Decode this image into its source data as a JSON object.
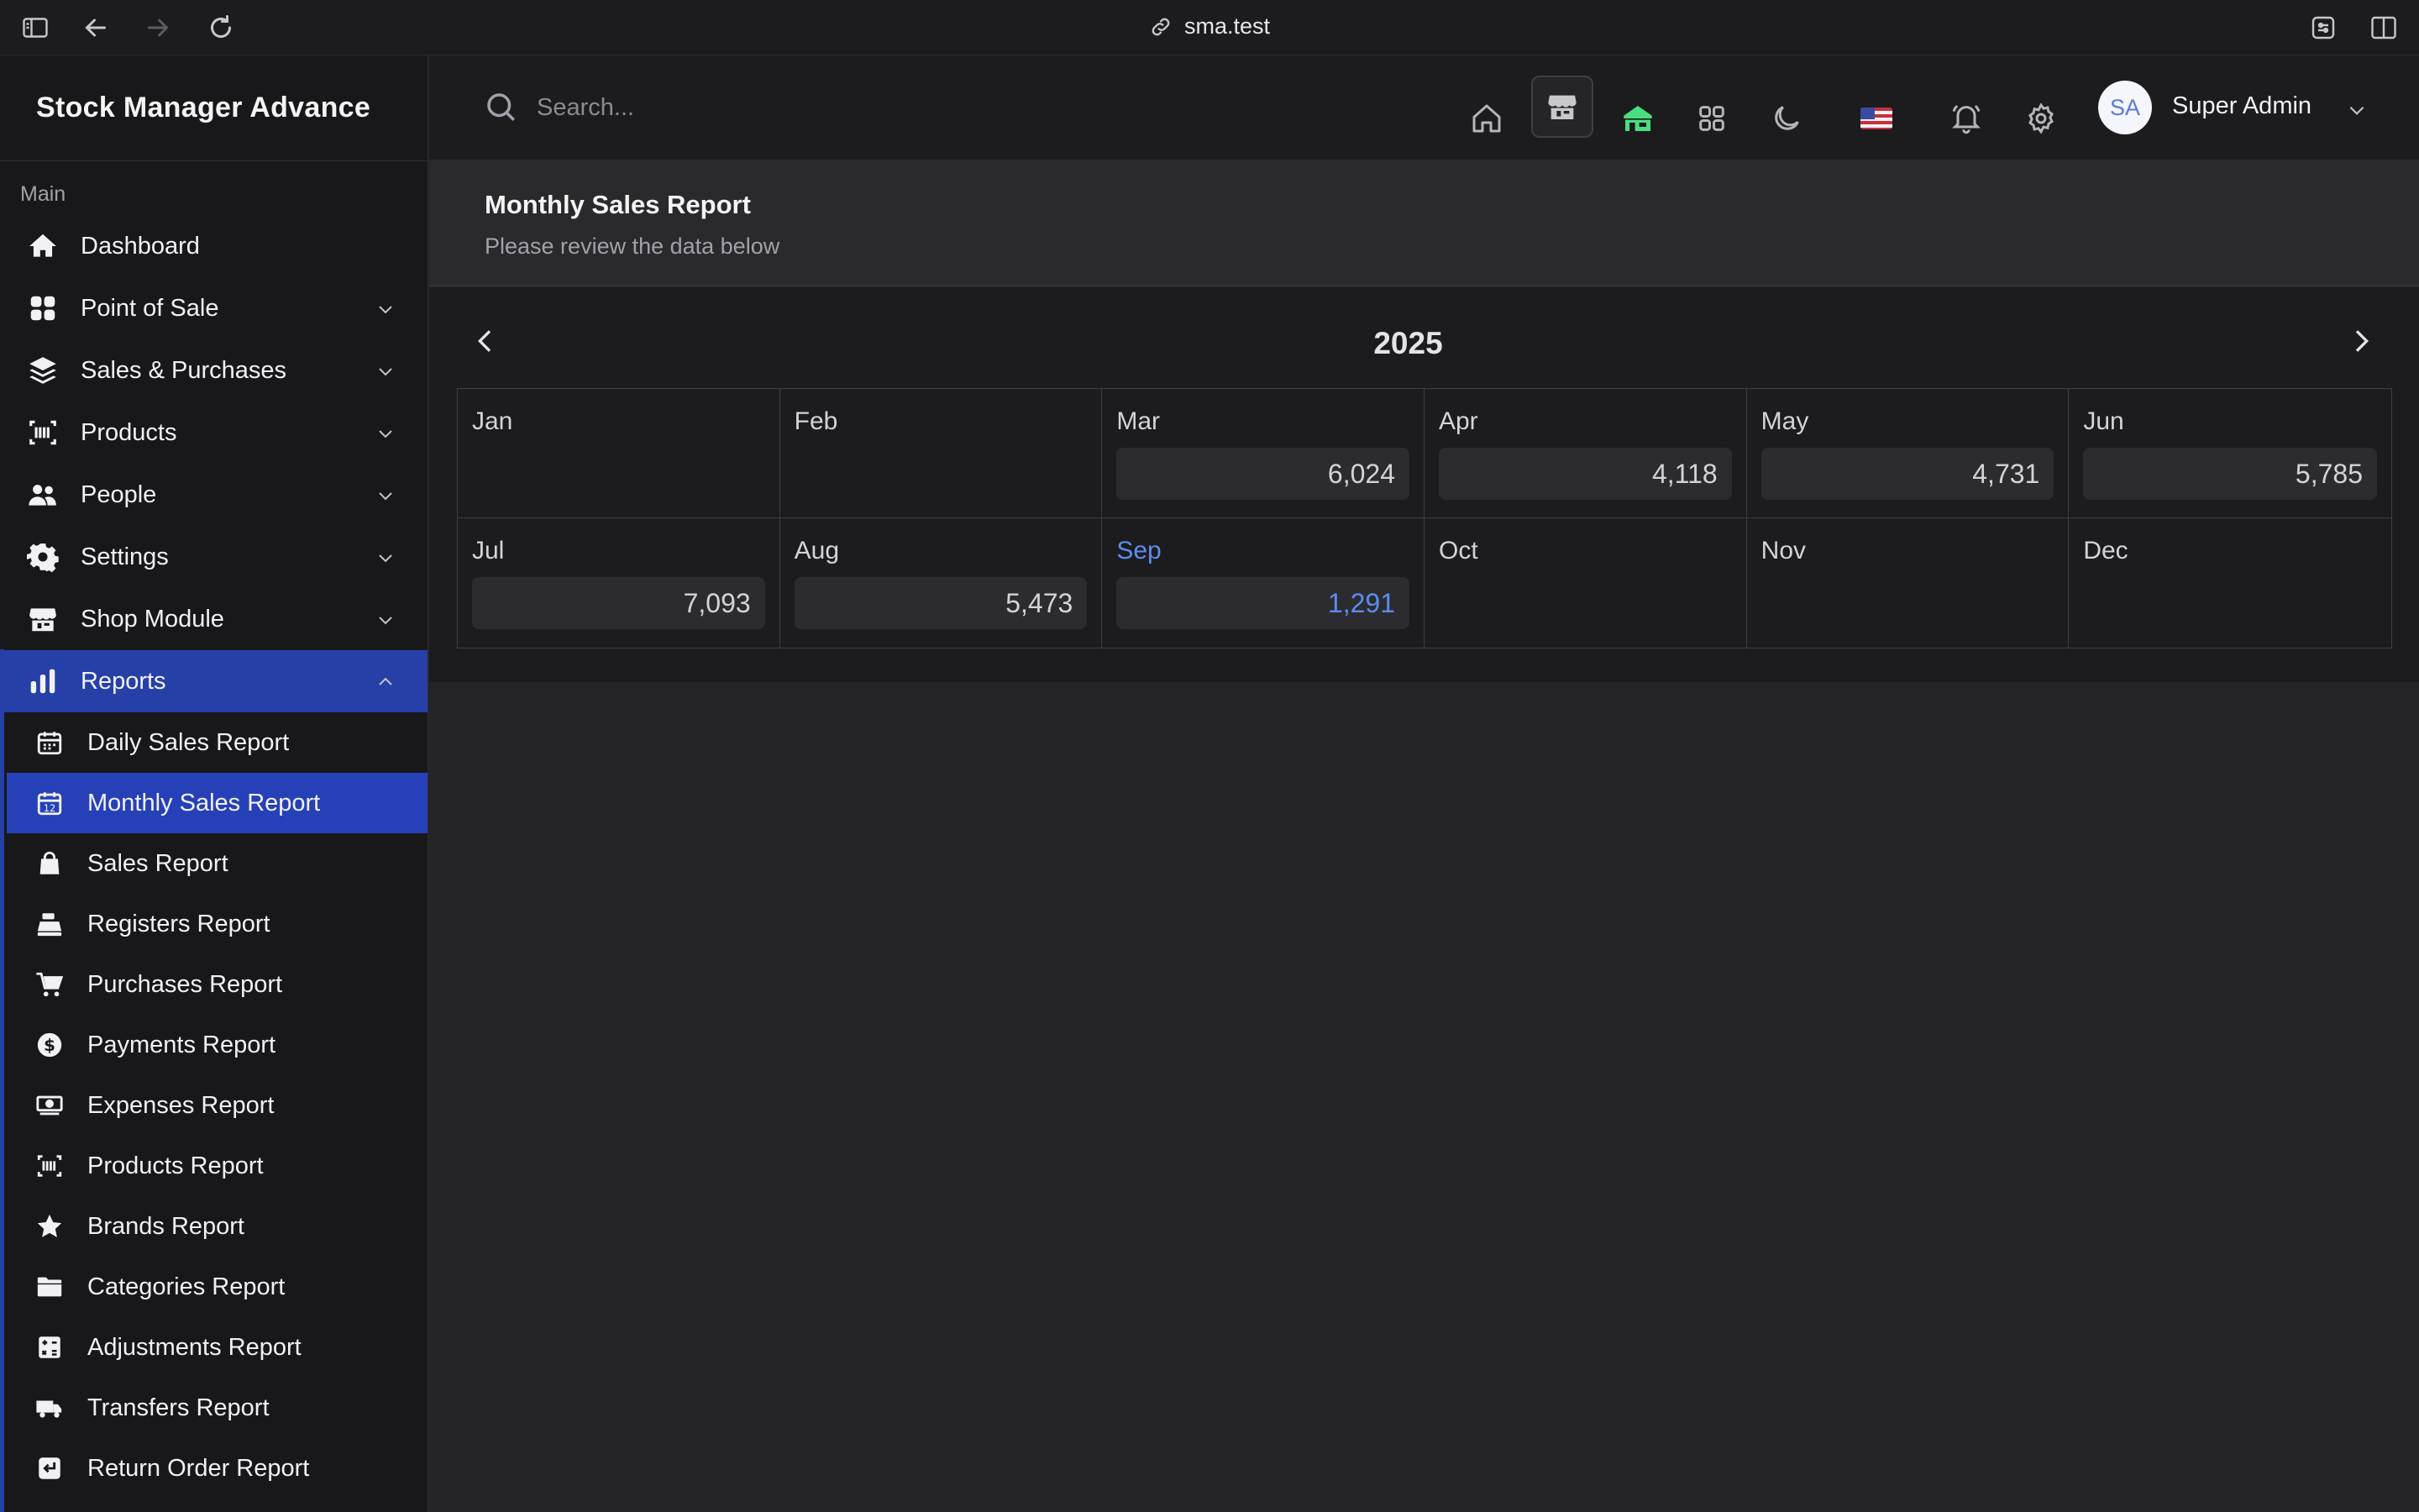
{
  "browser": {
    "url": "sma.test"
  },
  "brand": "Stock Manager Advance",
  "sidebar": {
    "section": "Main",
    "items": [
      {
        "label": "Dashboard",
        "icon": "home-icon"
      },
      {
        "label": "Point of Sale",
        "icon": "grid-icon"
      },
      {
        "label": "Sales & Purchases",
        "icon": "layers-icon"
      },
      {
        "label": "Products",
        "icon": "barcode-icon"
      },
      {
        "label": "People",
        "icon": "users-icon"
      },
      {
        "label": "Settings",
        "icon": "gear-icon"
      },
      {
        "label": "Shop Module",
        "icon": "store-icon"
      },
      {
        "label": "Reports",
        "icon": "bar-chart-icon"
      }
    ],
    "reports": [
      {
        "label": "Daily Sales Report",
        "icon": "calendar-icon"
      },
      {
        "label": "Monthly Sales Report",
        "icon": "calendar-12-icon"
      },
      {
        "label": "Sales Report",
        "icon": "shopping-bag-icon"
      },
      {
        "label": "Registers Report",
        "icon": "cash-register-icon"
      },
      {
        "label": "Purchases Report",
        "icon": "cart-icon"
      },
      {
        "label": "Payments Report",
        "icon": "dollar-circle-icon"
      },
      {
        "label": "Expenses Report",
        "icon": "money-icon"
      },
      {
        "label": "Products Report",
        "icon": "barcode-icon"
      },
      {
        "label": "Brands Report",
        "icon": "star-icon"
      },
      {
        "label": "Categories Report",
        "icon": "folder-icon"
      },
      {
        "label": "Adjustments Report",
        "icon": "calculator-icon"
      },
      {
        "label": "Transfers Report",
        "icon": "truck-icon"
      },
      {
        "label": "Return Order Report",
        "icon": "return-icon"
      }
    ]
  },
  "topbar": {
    "search_placeholder": "Search...",
    "user": {
      "initials": "SA",
      "name": "Super Admin"
    },
    "accent_green": "#4ade80"
  },
  "page": {
    "title": "Monthly Sales Report",
    "subtitle": "Please review the data below"
  },
  "calendar": {
    "year": "2025",
    "current_month_color": "#5b8def",
    "months": [
      {
        "name": "Jan",
        "value": ""
      },
      {
        "name": "Feb",
        "value": ""
      },
      {
        "name": "Mar",
        "value": "6,024"
      },
      {
        "name": "Apr",
        "value": "4,118"
      },
      {
        "name": "May",
        "value": "4,731"
      },
      {
        "name": "Jun",
        "value": "5,785"
      },
      {
        "name": "Jul",
        "value": "7,093"
      },
      {
        "name": "Aug",
        "value": "5,473"
      },
      {
        "name": "Sep",
        "value": "1,291",
        "current": true
      },
      {
        "name": "Oct",
        "value": ""
      },
      {
        "name": "Nov",
        "value": ""
      },
      {
        "name": "Dec",
        "value": ""
      }
    ]
  }
}
